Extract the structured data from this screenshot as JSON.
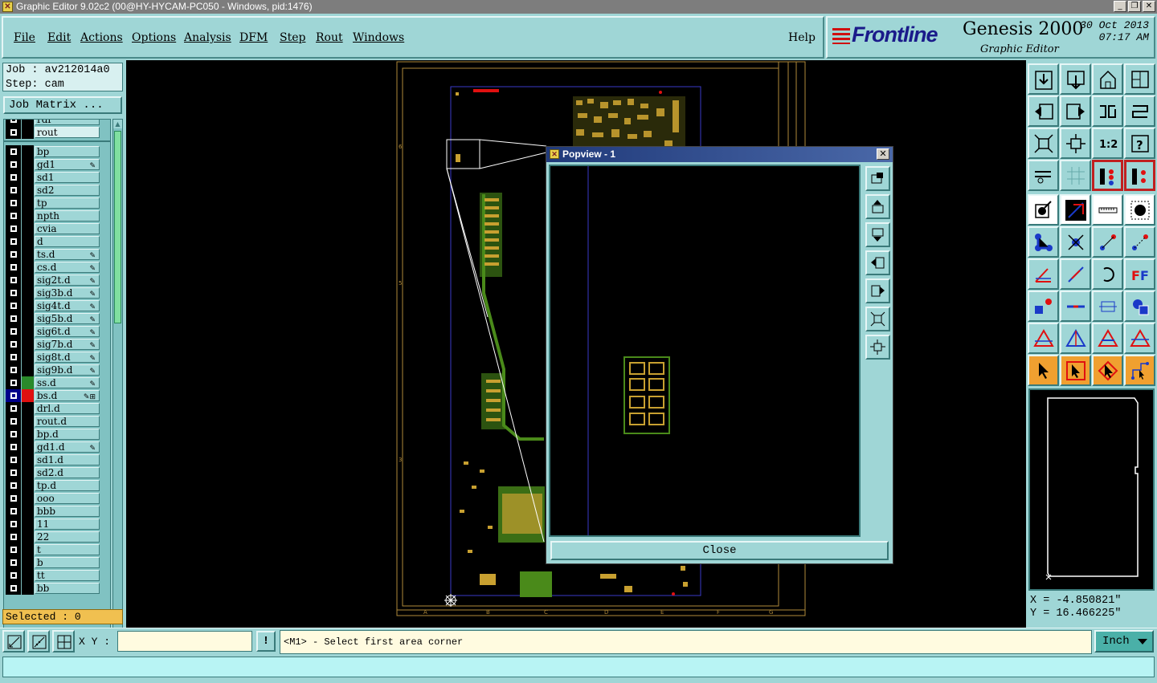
{
  "window": {
    "title": "Graphic Editor 9.02c2 (00@HY-HYCAM-PC050 - Windows, pid:1476)",
    "icon": "x-app-icon",
    "buttons": [
      "_",
      "❐",
      "✕"
    ]
  },
  "menubar": {
    "items": [
      "File",
      "Edit",
      "Actions",
      "Options",
      "Analysis",
      "DFM",
      "Step",
      "Rout",
      "Windows"
    ],
    "help": "Help"
  },
  "brand": {
    "logo": "Frontline",
    "product": "Genesis 2000",
    "subtitle": "Graphic Editor",
    "date": "30 Oct 2013",
    "time": "07:17 AM"
  },
  "left": {
    "job": "Job : av212014a0",
    "step": "Step: cam",
    "job_matrix": "Job Matrix ...",
    "selected": "Selected : 0",
    "layers": [
      {
        "name": "rdr",
        "color": "#000000",
        "mark": ""
      },
      {
        "name": "rout",
        "color": "#000000",
        "mark": ""
      },
      {
        "name": "bp",
        "color": "#000000",
        "mark": ""
      },
      {
        "name": "gd1",
        "color": "#000000",
        "mark": "✎"
      },
      {
        "name": "sd1",
        "color": "#000000",
        "mark": ""
      },
      {
        "name": "sd2",
        "color": "#000000",
        "mark": ""
      },
      {
        "name": "tp",
        "color": "#000000",
        "mark": ""
      },
      {
        "name": "npth",
        "color": "#000000",
        "mark": ""
      },
      {
        "name": "cvia",
        "color": "#000000",
        "mark": ""
      },
      {
        "name": "d",
        "color": "#000000",
        "mark": ""
      },
      {
        "name": "ts.d",
        "color": "#000000",
        "mark": "✎"
      },
      {
        "name": "cs.d",
        "color": "#000000",
        "mark": "✎"
      },
      {
        "name": "sig2t.d",
        "color": "#000000",
        "mark": "✎"
      },
      {
        "name": "sig3b.d",
        "color": "#000000",
        "mark": "✎"
      },
      {
        "name": "sig4t.d",
        "color": "#000000",
        "mark": "✎"
      },
      {
        "name": "sig5b.d",
        "color": "#000000",
        "mark": "✎"
      },
      {
        "name": "sig6t.d",
        "color": "#000000",
        "mark": "✎"
      },
      {
        "name": "sig7b.d",
        "color": "#000000",
        "mark": "✎"
      },
      {
        "name": "sig8t.d",
        "color": "#000000",
        "mark": "✎"
      },
      {
        "name": "sig9b.d",
        "color": "#000000",
        "mark": "✎"
      },
      {
        "name": "ss.d",
        "color": "#2a8a2a",
        "mark": "✎"
      },
      {
        "name": "bs.d",
        "color": "#e01010",
        "mark": "✎⊞",
        "selected": true
      },
      {
        "name": "drl.d",
        "color": "#000000",
        "mark": ""
      },
      {
        "name": "rout.d",
        "color": "#000000",
        "mark": ""
      },
      {
        "name": "bp.d",
        "color": "#000000",
        "mark": ""
      },
      {
        "name": "gd1.d",
        "color": "#000000",
        "mark": "✎"
      },
      {
        "name": "sd1.d",
        "color": "#000000",
        "mark": ""
      },
      {
        "name": "sd2.d",
        "color": "#000000",
        "mark": ""
      },
      {
        "name": "tp.d",
        "color": "#000000",
        "mark": ""
      },
      {
        "name": "ooo",
        "color": "#000000",
        "mark": ""
      },
      {
        "name": "bbb",
        "color": "#000000",
        "mark": ""
      },
      {
        "name": "11",
        "color": "#000000",
        "mark": ""
      },
      {
        "name": "22",
        "color": "#000000",
        "mark": ""
      },
      {
        "name": "t",
        "color": "#000000",
        "mark": ""
      },
      {
        "name": "b",
        "color": "#000000",
        "mark": ""
      },
      {
        "name": "tt",
        "color": "#000000",
        "mark": ""
      },
      {
        "name": "bb",
        "color": "#000000",
        "mark": ""
      }
    ]
  },
  "popview": {
    "title": "Popview - 1",
    "close_label": "Close",
    "tools": [
      "zoom-window-icon",
      "pan-up-icon",
      "pan-down-icon",
      "pan-left-icon",
      "pan-right-icon",
      "zoom-fit-icon",
      "zoom-home-icon"
    ]
  },
  "right": {
    "coords": {
      "x": "X = -4.850821\"",
      "y": "Y = 16.466225\""
    },
    "tool_icons": [
      "zoom-in-icon",
      "zoom-out-icon",
      "home-view-icon",
      "split-view-icon",
      "pan-left-icon",
      "pan-right-icon",
      "redraw-icon",
      "snake-icon",
      "fit-icon",
      "center-icon",
      "one-to-two-icon",
      "help-icon",
      "measure-icon",
      "grid-icon",
      "layer-toggle-icon",
      "layer-toggle-2-icon",
      "select-point-icon",
      "add-line-icon",
      "ruler-icon",
      "pad-icon",
      "move-icon",
      "delete-icon",
      "add-node-icon",
      "add-node-2-icon",
      "angle-icon",
      "line-icon",
      "arc-icon",
      "text-icon",
      "connect-icon",
      "cut-icon",
      "stretch-icon",
      "shape-icon",
      "triangle-icon",
      "tri-net-icon",
      "tri-a-icon",
      "tri-b-icon",
      "arrow-select-icon",
      "arrow-box-icon",
      "arrow-alt-icon",
      "net-select-icon"
    ],
    "one_to_two": "1:2"
  },
  "statusbar": {
    "xy_label": "X Y :",
    "xy_value": "",
    "excl": "!",
    "prompt": "<M1> - Select first area corner",
    "unit": "Inch"
  }
}
